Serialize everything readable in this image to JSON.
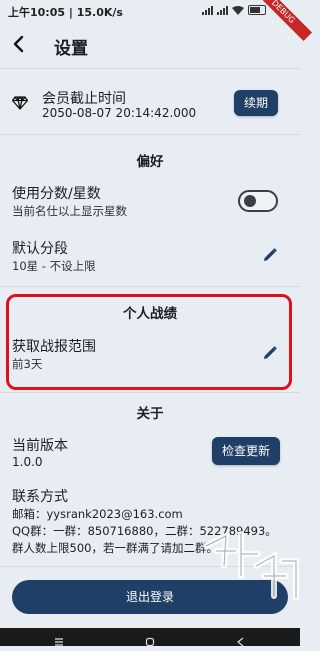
{
  "statusbar": {
    "time": "上午10:05",
    "speed": "15.0K/s",
    "debug": "DEBUG"
  },
  "appbar": {
    "title": "设置"
  },
  "membership": {
    "label": "会员截止时间",
    "date": "2050-08-07 20:14:42.000",
    "renew": "续期"
  },
  "preferences": {
    "heading": "偏好",
    "score_label": "使用分数/星数",
    "score_sub": "当前名仕以上显示星数",
    "score_toggle_on": false,
    "segment_label": "默认分段",
    "segment_value": "10星 - 不设上限"
  },
  "personal": {
    "heading": "个人战绩",
    "range_label": "获取战报范围",
    "range_value": "前3天"
  },
  "about": {
    "heading": "关于",
    "version_label": "当前版本",
    "version_value": "1.0.0",
    "check_update": "检查更新",
    "contact_label": "联系方式",
    "email": "邮箱：yysrank2023@163.com",
    "qq": "QQ群：一群：850716880，二群：522789493。",
    "note": "群人数上限500，若一群满了请加二群。"
  },
  "logout": "退出登录",
  "colors": {
    "primary": "#1f3f66",
    "highlight": "#e0111b",
    "background": "#e8edf3"
  }
}
